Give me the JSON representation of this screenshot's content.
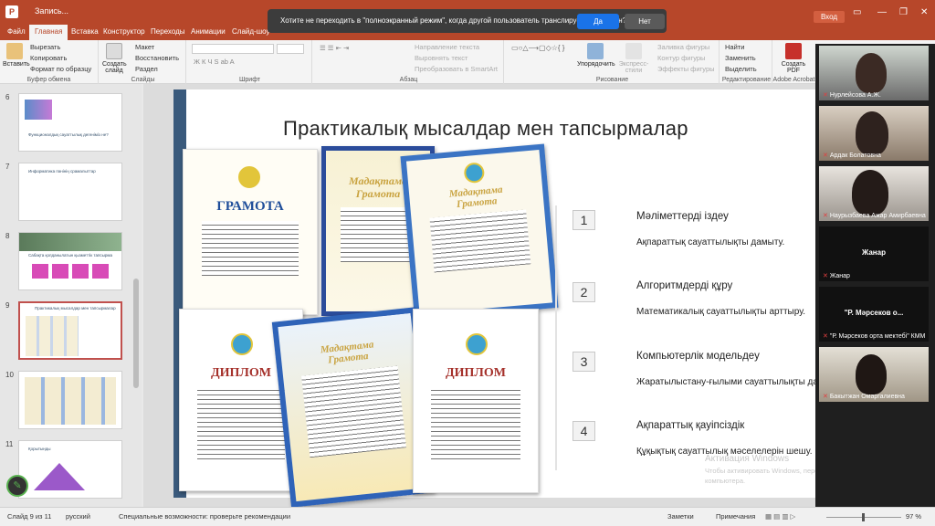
{
  "window": {
    "title": "Запись...",
    "signin": "Вход"
  },
  "notification": {
    "text": "Хотите не переходить в \"полноэкранный режим\", когда другой пользователь транслирует свой экран?",
    "yes": "Да",
    "no": "Нет"
  },
  "tabs": [
    "Файл",
    "Главная",
    "Вставка",
    "Конструктор",
    "Переходы",
    "Анимации",
    "Слайд-шоу"
  ],
  "ribbon": {
    "paste": "Вставить",
    "cut": "Вырезать",
    "copy": "Копировать",
    "format_painter": "Формат по образцу",
    "clipboard": "Буфер обмена",
    "new_slide": "Создать слайд",
    "layout": "Макет",
    "reset": "Восстановить",
    "section": "Раздел",
    "slides": "Слайды",
    "font": "Шрифт",
    "paragraph": "Абзац",
    "text_direction": "Направление текста",
    "align_text": "Выровнять текст",
    "smartart": "Преобразовать в SmartArt",
    "arrange": "Упорядочить",
    "quick_styles": "Экспресс-стили",
    "shape_fill": "Заливка фигуры",
    "shape_outline": "Контур фигуры",
    "shape_effects": "Эффекты фигуры",
    "drawing": "Рисование",
    "find": "Найти",
    "replace": "Заменить",
    "select": "Выделить",
    "editing": "Редактирование",
    "create_pdf": "Создать PDF",
    "acrobat": "Adobe Acrobat"
  },
  "thumbnails": [
    {
      "num": "6",
      "title": "Функционалдық сауаттылық дегеніміз не?"
    },
    {
      "num": "7",
      "title": "Информатика пәнінің срамалыттар"
    },
    {
      "num": "8",
      "title": "Сабақта қолданылатын қызметтік тапсырма"
    },
    {
      "num": "9",
      "title": "Практикалық мысалдар мен тапсырмалар"
    },
    {
      "num": "10",
      "title": ""
    },
    {
      "num": "11",
      "title": "Қорытынды"
    }
  ],
  "slide": {
    "title": "Практикалық мысалдар мен тапсырмалар",
    "certificates": {
      "gramota": "ГРАМОТА",
      "madaktama": "Мадақтама",
      "gramota2": "Грамота",
      "diplom": "ДИПЛОМ"
    },
    "steps": [
      {
        "num": "1",
        "title": "Мәліметтерді іздеу",
        "sub": "Ақпараттық сауаттылықты дамыту."
      },
      {
        "num": "2",
        "title": "Алгоритмдерді құру",
        "sub": "Математикалық сауаттылықты арттыру."
      },
      {
        "num": "3",
        "title": "Компьютерлік модельдеу",
        "sub": "Жаратылыстану-ғылыми сауаттылықты дамыту."
      },
      {
        "num": "4",
        "title": "Ақпараттық қауіпсіздік",
        "sub": "Құқықтық сауаттылық мәселелерін шешу."
      }
    ],
    "watermark_title": "Активация Windows",
    "watermark_text": "Чтобы активировать Windows, перейдите к параметрам компьютера."
  },
  "participants": [
    {
      "name": "Нурлейсова А.Ж.",
      "video": true
    },
    {
      "name": "Ардак Болатовна",
      "video": true
    },
    {
      "name": "Наурызбаева Ажар Амирбаевна",
      "video": true
    },
    {
      "name": "Жанар",
      "label": "Жанар",
      "video": false
    },
    {
      "name": "\"Р. Мәрсеков орта мектебі\" КММ",
      "label": "\"Р. Мәрсеков о...",
      "video": false
    },
    {
      "name": "Бакытжан Омаргалиевна",
      "video": true
    }
  ],
  "status": {
    "slide": "Слайд 9 из 11",
    "language": "русский",
    "accessibility": "Специальные возможности: проверьте рекомендации",
    "notes": "Заметки",
    "comments": "Примечания",
    "zoom": "97 %"
  },
  "colors": {
    "accent": "#b7472a",
    "selected_thumb": "#c0504d",
    "notify_blue": "#1a73e8"
  }
}
